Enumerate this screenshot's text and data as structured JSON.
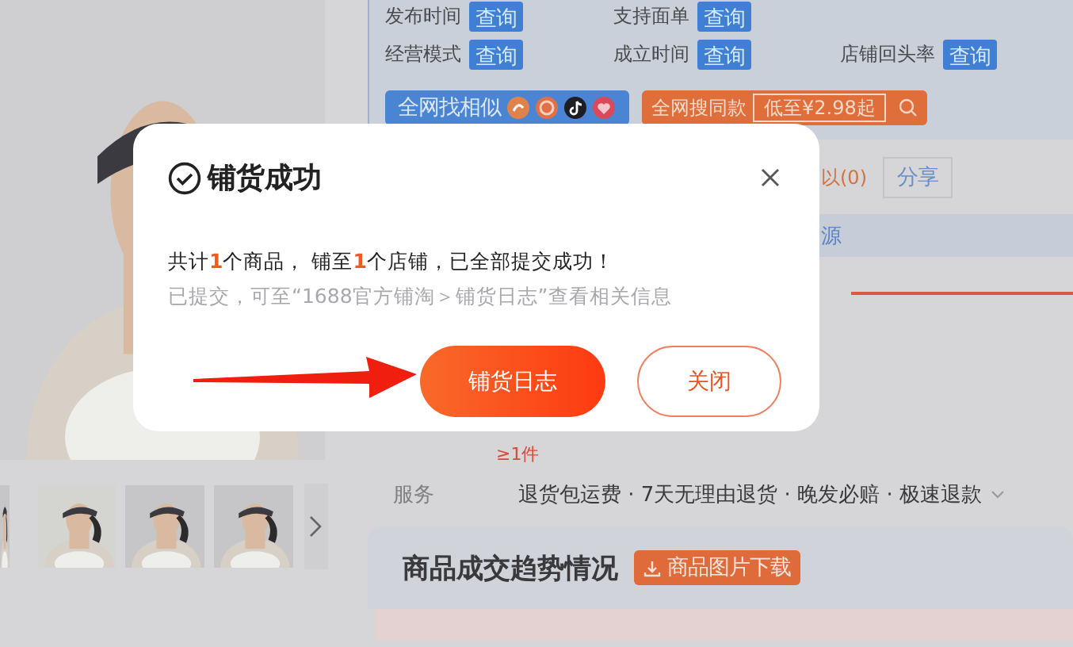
{
  "shop_info": {
    "rows": [
      [
        {
          "label": "发布时间",
          "button": "查询"
        },
        {
          "label": "支持面单",
          "button": "查询"
        }
      ],
      [
        {
          "label": "经营模式",
          "button": "查询"
        },
        {
          "label": "成立时间",
          "button": "查询"
        },
        {
          "label": "店铺回头率",
          "button": "查询"
        }
      ]
    ]
  },
  "search_bar": {
    "similar": {
      "label": "全网找相似"
    },
    "same": {
      "label": "全网搜同款",
      "price": "低至¥2.98起"
    }
  },
  "actions": {
    "similar_count": "以(0)",
    "share": "分享"
  },
  "source_tab": "源",
  "min_order": "≥1件",
  "services": {
    "label": "服务",
    "value": "退货包运费 · 7天无理由退货 · 晚发必赔 · 极速退款"
  },
  "trend": {
    "title": "商品成交趋势情况",
    "download_button": "商品图片下载"
  },
  "dialog": {
    "title": "铺货成功",
    "message": "共计**1**个商品， 铺至**1**个店铺，已全部提交成功！",
    "note": "已提交，可至“1688官方铺淘＞铺货日志”查看相关信息",
    "buttons": [
      {
        "label": "铺货日志",
        "kind": "primary"
      },
      {
        "label": "关闭",
        "kind": "secondary"
      }
    ]
  }
}
